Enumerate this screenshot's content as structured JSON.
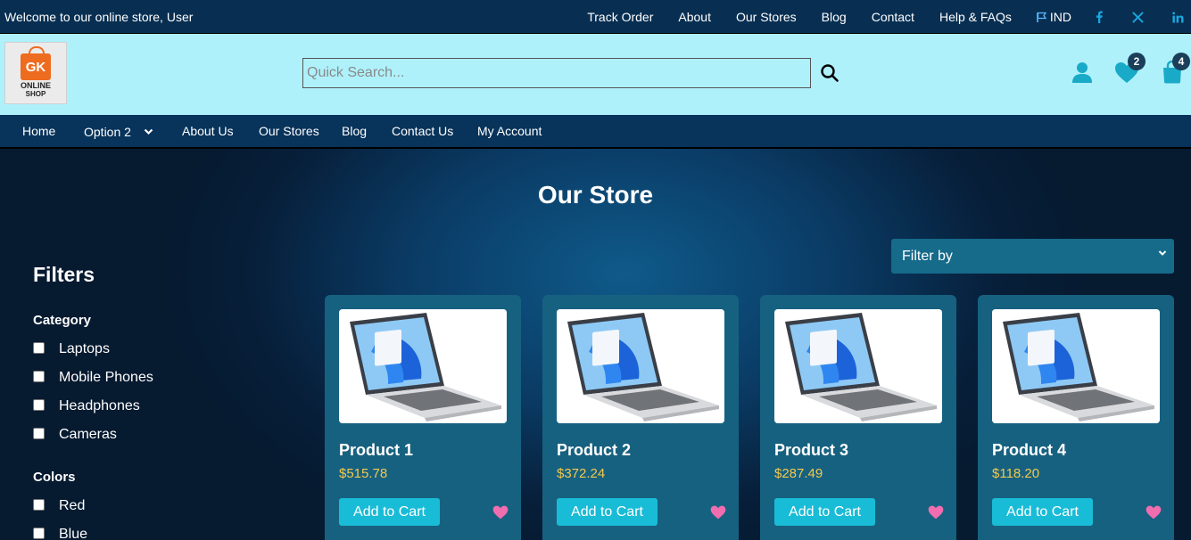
{
  "topbar": {
    "welcome": "Welcome to our online store, User",
    "links": [
      "Track Order",
      "About",
      "Our Stores",
      "Blog",
      "Contact",
      "Help & FAQs"
    ],
    "language": "IND",
    "social": [
      "facebook-icon",
      "x-icon",
      "linkedin-icon"
    ]
  },
  "header": {
    "logo_top": "GK",
    "logo_line1": "ONLINE",
    "logo_line2": "SHOP",
    "search_placeholder": "Quick Search...",
    "wishlist_count": "2",
    "cart_count": "4"
  },
  "nav": {
    "items": [
      "Home",
      "Option 2",
      "About Us",
      "Our Stores",
      "Blog",
      "Contact Us",
      "My Account"
    ]
  },
  "main": {
    "title": "Our Store",
    "filter_select": "Filter by",
    "filters_title": "Filters",
    "category_title": "Category",
    "categories": [
      "Laptops",
      "Mobile Phones",
      "Headphones",
      "Cameras"
    ],
    "colors_title": "Colors",
    "colors": [
      "Red",
      "Blue"
    ],
    "add_label": "Add to Cart",
    "products": [
      {
        "name": "Product 1",
        "price": "$515.78"
      },
      {
        "name": "Product 2",
        "price": "$372.24"
      },
      {
        "name": "Product 3",
        "price": "$287.49"
      },
      {
        "name": "Product 4",
        "price": "$118.20"
      }
    ]
  },
  "colors": {
    "topbar": "#082f52",
    "header": "#aef1fb",
    "accent": "#19bcd6",
    "card": "#176180",
    "price": "#f2c94c",
    "heart": "#f06daf"
  }
}
